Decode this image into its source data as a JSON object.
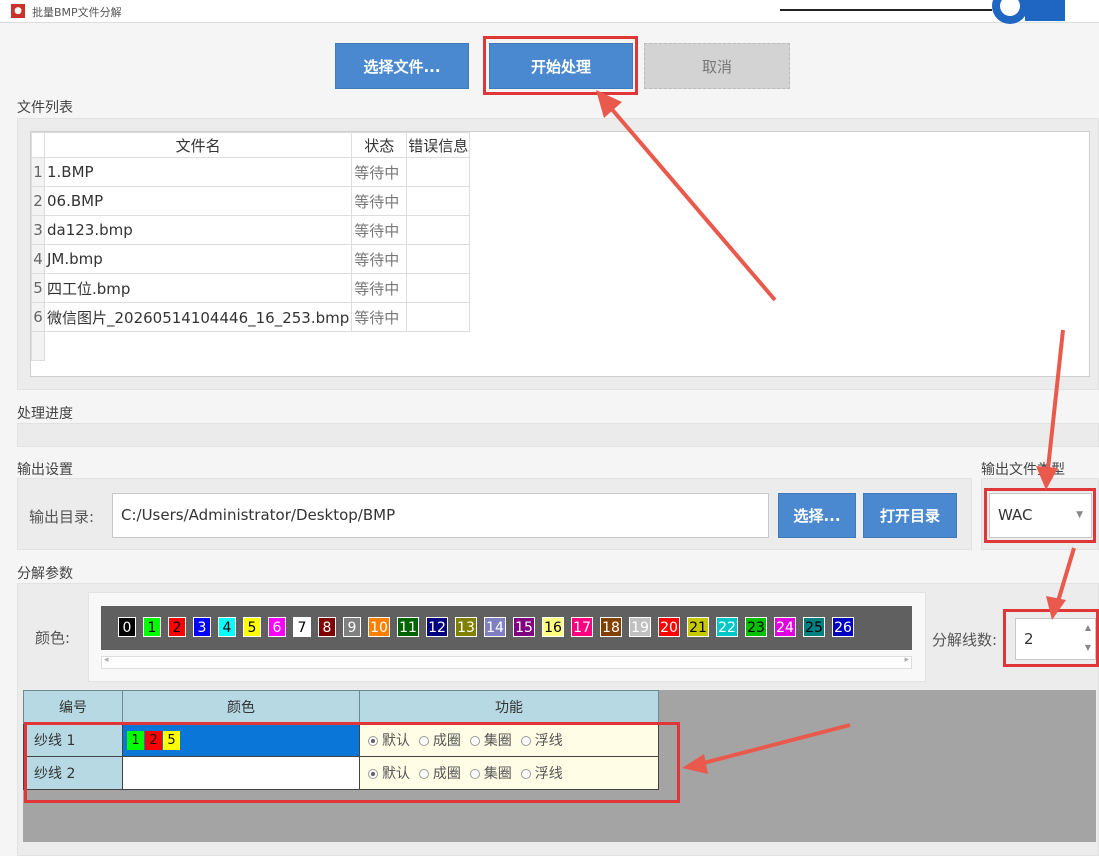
{
  "window": {
    "title": "批量BMP文件分解",
    "icon": "app-logo-icon"
  },
  "toolbar": {
    "select_files": "选择文件...",
    "start": "开始处理",
    "cancel": "取消"
  },
  "file_list": {
    "section_label": "文件列表",
    "columns": [
      "文件名",
      "状态",
      "错误信息"
    ],
    "rows": [
      {
        "n": "1",
        "name": "1.BMP",
        "status": "等待中",
        "error": ""
      },
      {
        "n": "2",
        "name": "06.BMP",
        "status": "等待中",
        "error": ""
      },
      {
        "n": "3",
        "name": "da123.bmp",
        "status": "等待中",
        "error": ""
      },
      {
        "n": "4",
        "name": "JM.bmp",
        "status": "等待中",
        "error": ""
      },
      {
        "n": "5",
        "name": "四工位.bmp",
        "status": "等待中",
        "error": ""
      },
      {
        "n": "6",
        "name": "微信图片_20260514104446_16_253.bmp",
        "status": "等待中",
        "error": ""
      }
    ]
  },
  "progress": {
    "section_label": "处理进度",
    "value": 0
  },
  "output": {
    "section_label": "输出设置",
    "dir_label": "输出目录:",
    "dir_value": "C:/Users/Administrator/Desktop/BMP",
    "choose": "选择...",
    "open_dir": "打开目录",
    "type_label": "输出文件类型",
    "type_value": "WAC"
  },
  "params": {
    "section_label": "分解参数",
    "color_label": "颜色:",
    "yarn_count_label": "分解线数:",
    "yarn_count_value": "2",
    "palette": [
      {
        "n": "0",
        "bg": "#000000",
        "fg": "#ffffff"
      },
      {
        "n": "1",
        "bg": "#00ff00",
        "fg": "#000000"
      },
      {
        "n": "2",
        "bg": "#ff0000",
        "fg": "#000000"
      },
      {
        "n": "3",
        "bg": "#0000ff",
        "fg": "#ffffff"
      },
      {
        "n": "4",
        "bg": "#00ffff",
        "fg": "#000000"
      },
      {
        "n": "5",
        "bg": "#ffff00",
        "fg": "#000000"
      },
      {
        "n": "6",
        "bg": "#ff00ff",
        "fg": "#ffffff"
      },
      {
        "n": "7",
        "bg": "#ffffff",
        "fg": "#000000"
      },
      {
        "n": "8",
        "bg": "#800000",
        "fg": "#ffffff"
      },
      {
        "n": "9",
        "bg": "#808080",
        "fg": "#ffffff"
      },
      {
        "n": "10",
        "bg": "#ff8000",
        "fg": "#ffffff"
      },
      {
        "n": "11",
        "bg": "#006400",
        "fg": "#ffffff"
      },
      {
        "n": "12",
        "bg": "#000080",
        "fg": "#ffffff"
      },
      {
        "n": "13",
        "bg": "#808000",
        "fg": "#ffffff"
      },
      {
        "n": "14",
        "bg": "#8080c0",
        "fg": "#ffffff"
      },
      {
        "n": "15",
        "bg": "#800080",
        "fg": "#ffffff"
      },
      {
        "n": "16",
        "bg": "#ffff80",
        "fg": "#000000"
      },
      {
        "n": "17",
        "bg": "#ff0080",
        "fg": "#ffffff"
      },
      {
        "n": "18",
        "bg": "#804000",
        "fg": "#ffffff"
      },
      {
        "n": "19",
        "bg": "#c0c0c0",
        "fg": "#ffffff"
      },
      {
        "n": "20",
        "bg": "#ff0000",
        "fg": "#ffffff"
      },
      {
        "n": "21",
        "bg": "#c8c800",
        "fg": "#000000"
      },
      {
        "n": "22",
        "bg": "#00c8c8",
        "fg": "#ffffff"
      },
      {
        "n": "23",
        "bg": "#00c000",
        "fg": "#000000"
      },
      {
        "n": "24",
        "bg": "#e000e0",
        "fg": "#ffffff"
      },
      {
        "n": "25",
        "bg": "#008080",
        "fg": "#000000"
      },
      {
        "n": "26",
        "bg": "#0000c0",
        "fg": "#ffffff"
      }
    ]
  },
  "yarn_table": {
    "columns": [
      "编号",
      "颜色",
      "功能"
    ],
    "rows": [
      {
        "id": "纱线 1",
        "colors": [
          {
            "n": "1",
            "bg": "#00ff00"
          },
          {
            "n": "2",
            "bg": "#ff0000"
          },
          {
            "n": "5",
            "bg": "#ffff00"
          }
        ],
        "selected": true
      },
      {
        "id": "纱线 2",
        "colors": [],
        "selected": false
      }
    ],
    "functions": [
      "默认",
      "成圈",
      "集圈",
      "浮线"
    ]
  }
}
